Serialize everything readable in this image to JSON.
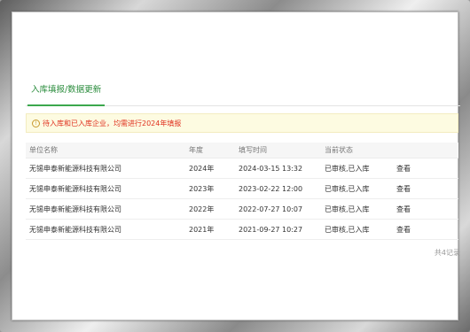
{
  "tabs": [
    {
      "label": "入库填报/数据更新",
      "active": true
    }
  ],
  "notice": {
    "icon": "info-icon",
    "text": "待入库和已入库企业，均需进行2024年填报"
  },
  "table": {
    "headers": [
      "单位名称",
      "年度",
      "填写时间",
      "当前状态",
      ""
    ],
    "rows": [
      {
        "name": "无锡申泰新能源科技有限公司",
        "year": "2024年",
        "time": "2024-03-15 13:32",
        "status": "已审核,已入库",
        "action": "查看"
      },
      {
        "name": "无锡申泰新能源科技有限公司",
        "year": "2023年",
        "time": "2023-02-22 12:00",
        "status": "已审核,已入库",
        "action": "查看"
      },
      {
        "name": "无锡申泰新能源科技有限公司",
        "year": "2022年",
        "time": "2022-07-27 10:07",
        "status": "已审核,已入库",
        "action": "查看"
      },
      {
        "name": "无锡申泰新能源科技有限公司",
        "year": "2021年",
        "time": "2021-09-27 10:27",
        "status": "已审核,已入库",
        "action": "查看"
      }
    ]
  },
  "pager": {
    "total_text": "共4记录"
  },
  "colors": {
    "accent": "#2a8c3c",
    "notice_text": "#e0301e",
    "notice_bg": "#fdfbe1"
  }
}
